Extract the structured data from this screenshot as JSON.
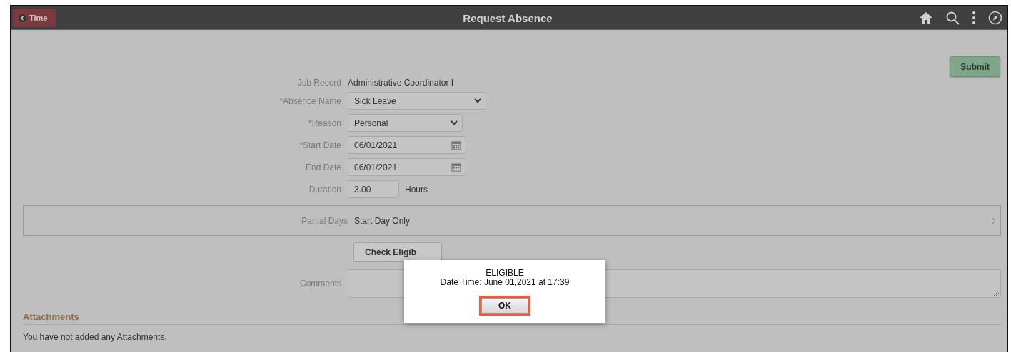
{
  "header": {
    "back_button": "Time",
    "title": "Request Absence"
  },
  "submit_button": "Submit",
  "form": [
    {
      "kind": "text",
      "label": "Job Record",
      "value": "Administrative Coordinator I"
    },
    {
      "kind": "select",
      "label": "*Absence Name",
      "value": "Sick Leave"
    },
    {
      "kind": "select",
      "label": "*Reason",
      "value": "Personal"
    },
    {
      "kind": "date",
      "label": "*Start Date",
      "value": "06/01/2021"
    },
    {
      "kind": "date",
      "label": "End Date",
      "value": "06/01/2021"
    },
    {
      "kind": "number",
      "label": "Duration",
      "value": "3.00",
      "unit": "Hours"
    }
  ],
  "partial_days": {
    "label": "Partial Days",
    "value": "Start Day Only"
  },
  "check_button": "Check Eligib",
  "comments": {
    "label": "Comments"
  },
  "attachments": {
    "heading": "Attachments",
    "message": "You have not added any Attachments."
  },
  "dialog": {
    "status": "ELIGIBLE",
    "detail": "Date Time: June 01,2021 at 17:39",
    "ok_button": "OK",
    "ok_highlighted": true
  }
}
